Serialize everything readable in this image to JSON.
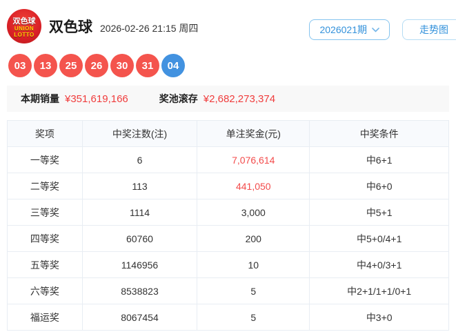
{
  "header": {
    "logo": {
      "line1": "双色球",
      "line2": "UNION",
      "line3": "LOTTO"
    },
    "title": "双色球",
    "datetime": "2026-02-26 21:15 周四",
    "period_selected": "2026021期",
    "trend_button_label": "走势图"
  },
  "balls": {
    "red": [
      "03",
      "13",
      "25",
      "26",
      "30",
      "31"
    ],
    "blue": [
      "04"
    ]
  },
  "summary": {
    "sales_label": "本期销量",
    "sales_value": "¥351,619,166",
    "pool_label": "奖池滚存",
    "pool_value": "¥2,682,273,374"
  },
  "table": {
    "headers": [
      "奖项",
      "中奖注数(注)",
      "单注奖金(元)",
      "中奖条件"
    ],
    "rows": [
      {
        "prize": "一等奖",
        "count": "6",
        "amount": "7,076,614",
        "condition": "中6+1",
        "amount_red": true
      },
      {
        "prize": "二等奖",
        "count": "113",
        "amount": "441,050",
        "condition": "中6+0",
        "amount_red": true
      },
      {
        "prize": "三等奖",
        "count": "1114",
        "amount": "3,000",
        "condition": "中5+1",
        "amount_red": false
      },
      {
        "prize": "四等奖",
        "count": "60760",
        "amount": "200",
        "condition": "中5+0/4+1",
        "amount_red": false
      },
      {
        "prize": "五等奖",
        "count": "1146956",
        "amount": "10",
        "condition": "中4+0/3+1",
        "amount_red": false
      },
      {
        "prize": "六等奖",
        "count": "8538823",
        "amount": "5",
        "condition": "中2+1/1+1/0+1",
        "amount_red": false
      },
      {
        "prize": "福运奖",
        "count": "8067454",
        "amount": "5",
        "condition": "中3+0",
        "amount_red": false
      }
    ]
  },
  "colors": {
    "red_ball": "#f4544d",
    "blue_ball": "#4292e0",
    "accent_blue": "#3291db",
    "value_red": "#f03c3c",
    "table_border": "#e8edf3"
  }
}
